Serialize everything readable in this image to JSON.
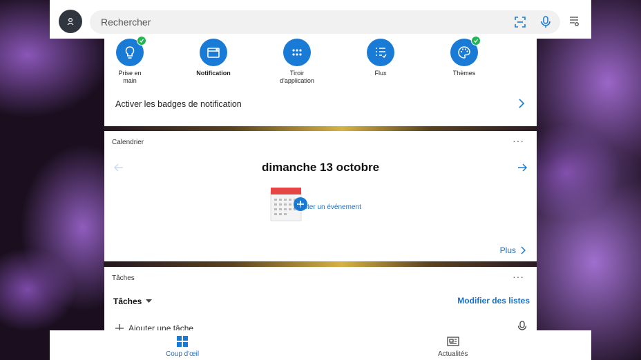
{
  "topbar": {
    "search_placeholder": "Rechercher",
    "icons": [
      "avatar-icon",
      "scan-icon",
      "mic-icon",
      "settings-icon"
    ]
  },
  "shortcuts": [
    {
      "label": "Prise en\nmain",
      "icon": "lightbulb-icon",
      "checked": true,
      "bold": false
    },
    {
      "label": "Notification",
      "icon": "notification-icon",
      "checked": false,
      "bold": true
    },
    {
      "label": "Tiroir\nd'application",
      "icon": "app-drawer-icon",
      "checked": false,
      "bold": false
    },
    {
      "label": "Flux",
      "icon": "feed-icon",
      "checked": false,
      "bold": false
    },
    {
      "label": "Thèmes",
      "icon": "palette-icon",
      "checked": true,
      "bold": false
    }
  ],
  "badges": {
    "label": "Activer les badges de notification"
  },
  "calendar": {
    "title": "Calendrier",
    "menu": "···",
    "date": "dimanche 13 octobre",
    "add_event": "Ajouter un événement",
    "more": "Plus"
  },
  "tasks": {
    "title": "Tâches",
    "menu": "···",
    "list_name": "Tâches",
    "edit_lists": "Modifier des listes",
    "add_task": "Ajouter une tâche"
  },
  "bottom_nav": {
    "glance": "Coup d'œil",
    "news": "Actualités"
  },
  "colors": {
    "accent": "#1a7bd6",
    "check": "#21b553"
  }
}
